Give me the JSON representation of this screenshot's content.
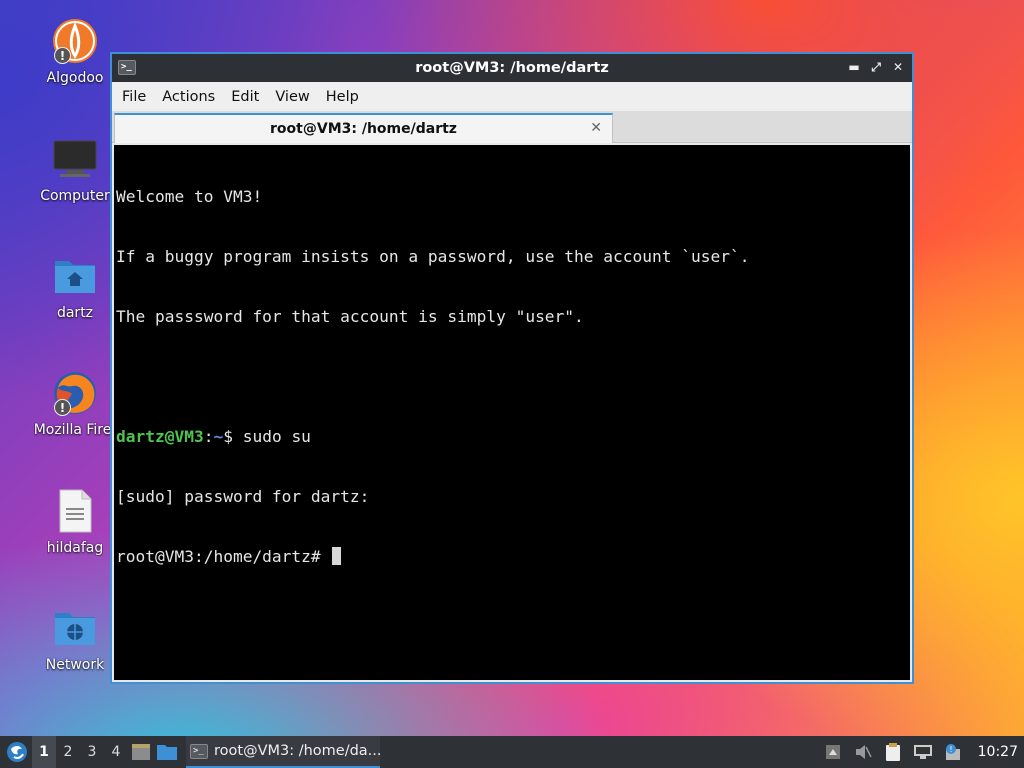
{
  "desktop": {
    "icons": [
      {
        "label": "Algodoo",
        "icon": "algodoo-icon"
      },
      {
        "label": "Computer",
        "icon": "computer-icon"
      },
      {
        "label": "dartz",
        "icon": "home-folder-icon"
      },
      {
        "label": "Mozilla Firef",
        "icon": "firefox-icon"
      },
      {
        "label": "hildafag",
        "icon": "text-file-icon"
      },
      {
        "label": "Network",
        "icon": "network-folder-icon"
      }
    ]
  },
  "window": {
    "title": "root@VM3: /home/dartz",
    "menu": [
      "File",
      "Actions",
      "Edit",
      "View",
      "Help"
    ],
    "tab_title": "root@VM3: /home/dartz",
    "accent_color": "#3d8fd6"
  },
  "terminal": {
    "lines": [
      "Welcome to VM3!",
      "If a buggy program insists on a password, use the account `user`.",
      "The passsword for that account is simply \"user\".",
      ""
    ],
    "prompt_user": "dartz@VM3",
    "prompt_sep": ":",
    "prompt_path": "~",
    "prompt_cmd": "$ sudo su",
    "sudo_line": "[sudo] password for dartz:",
    "root_prompt": "root@VM3:/home/dartz# "
  },
  "taskbar": {
    "workspaces": [
      "1",
      "2",
      "3",
      "4"
    ],
    "active_workspace": "1",
    "task_label": "root@VM3: /home/da...",
    "clock": "10:27"
  }
}
